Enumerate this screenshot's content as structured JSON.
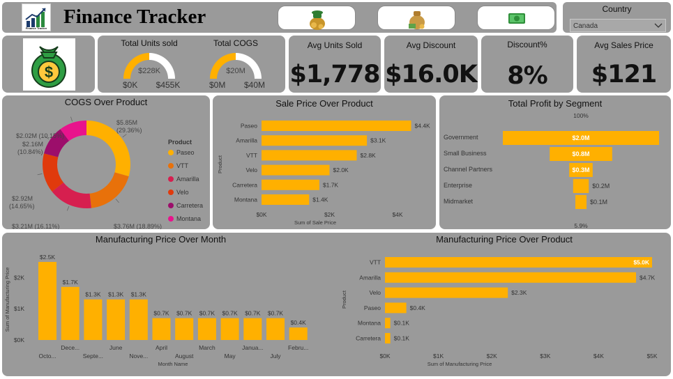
{
  "header": {
    "app_title": "Finance Tracker",
    "logo_caption": "Finance Tracker",
    "country_label": "Country",
    "country_value": "Canada"
  },
  "kpis": {
    "units_sold": {
      "label": "Total Units sold",
      "center": "$228K",
      "min": "$0K",
      "max": "$455K",
      "fraction": 0.5
    },
    "cogs": {
      "label": "Total COGS",
      "center": "$20M",
      "min": "$0M",
      "max": "$40M",
      "fraction": 0.5
    },
    "avg_units_sold": {
      "label": "Avg Units Sold",
      "value": "$1,778"
    },
    "avg_discount": {
      "label": "Avg Discount",
      "value": "$16.0K"
    },
    "discount_pct": {
      "label": "Discount%",
      "value": "8%"
    },
    "avg_sales_price": {
      "label": "Avg Sales Price",
      "value": "$121"
    }
  },
  "colors": {
    "accent": "#FFB000",
    "card": "#9A9A9A",
    "donut": [
      "#FFB000",
      "#E8710A",
      "#D61F4F",
      "#E03A0C",
      "#9C0E6B",
      "#E8138C"
    ]
  },
  "chart_data": [
    {
      "id": "cogs_over_product",
      "type": "pie",
      "title": "COGS Over Product",
      "legend_title": "Product",
      "legend_position": "right",
      "categories": [
        "Paseo",
        "VTT",
        "Amarilla",
        "Velo",
        "Carretera",
        "Montana"
      ],
      "values": [
        5.85,
        3.76,
        3.21,
        2.92,
        2.16,
        2.02
      ],
      "labels": [
        "$5.85M (29.36%)",
        "$3.76M (18.89%)",
        "$3.21M (16.11%)",
        "$2.92M (14.65%)",
        "$2.16M (10.84%)",
        "$2.02M (10.15%)"
      ]
    },
    {
      "id": "sale_price_over_product",
      "type": "bar",
      "orientation": "horizontal",
      "title": "Sale Price Over Product",
      "xlabel": "Sum of Sale Price",
      "ylabel": "Product",
      "categories": [
        "Paseo",
        "Amarilla",
        "VTT",
        "Velo",
        "Carretera",
        "Montana"
      ],
      "values": [
        4.4,
        3.1,
        2.8,
        2.0,
        1.7,
        1.4
      ],
      "value_labels": [
        "$4.4K",
        "$3.1K",
        "$2.8K",
        "$2.0K",
        "$1.7K",
        "$1.4K"
      ],
      "xlim": [
        0,
        4.8
      ],
      "ticks": [
        0,
        2,
        4
      ],
      "tick_labels": [
        "$0K",
        "$2K",
        "$4K"
      ]
    },
    {
      "id": "total_profit_by_segment",
      "type": "bar",
      "orientation": "funnel",
      "title": "Total Profit by Segment",
      "top_label": "100%",
      "bottom_label": "5.9%",
      "categories": [
        "Government",
        "Small Business",
        "Channel Partners",
        "Enterprise",
        "Midmarket"
      ],
      "values": [
        2.0,
        0.8,
        0.3,
        0.2,
        0.1
      ],
      "value_labels": [
        "$2.0M",
        "$0.8M",
        "$0.3M",
        "$0.2M",
        "$0.1M"
      ]
    },
    {
      "id": "manufacturing_price_over_month",
      "type": "bar",
      "title": "Manufacturing Price Over Month",
      "xlabel": "Month Name",
      "ylabel": "Sum of Manufacturing Price",
      "categories": [
        "Octo...",
        "Dece...",
        "Septe...",
        "June",
        "Nove...",
        "April",
        "August",
        "March",
        "May",
        "Janua...",
        "July",
        "Febru..."
      ],
      "values": [
        2.5,
        1.7,
        1.3,
        1.3,
        1.3,
        0.7,
        0.7,
        0.7,
        0.7,
        0.7,
        0.7,
        0.4
      ],
      "value_labels": [
        "$2.5K",
        "$1.7K",
        "$1.3K",
        "$1.3K",
        "$1.3K",
        "$0.7K",
        "$0.7K",
        "$0.7K",
        "$0.7K",
        "$0.7K",
        "$0.7K",
        "$0.4K"
      ],
      "ylim": [
        0,
        2.7
      ],
      "ticks": [
        0,
        1,
        2
      ],
      "tick_labels": [
        "$0K",
        "$1K",
        "$2K"
      ]
    },
    {
      "id": "manufacturing_price_over_product",
      "type": "bar",
      "orientation": "horizontal",
      "title": "Manufacturing Price Over Product",
      "xlabel": "Sum of Manufacturing Price",
      "ylabel": "Product",
      "categories": [
        "VTT",
        "Amarilla",
        "Velo",
        "Paseo",
        "Montana",
        "Carretera"
      ],
      "values": [
        5.0,
        4.7,
        2.3,
        0.4,
        0.1,
        0.1
      ],
      "value_labels": [
        "$5.0K",
        "$4.7K",
        "$2.3K",
        "$0.4K",
        "$0.1K",
        "$0.1K"
      ],
      "xlim": [
        0,
        5
      ],
      "ticks": [
        0,
        1,
        2,
        3,
        4,
        5
      ],
      "tick_labels": [
        "$0K",
        "$1K",
        "$2K",
        "$3K",
        "$4K",
        "$5K"
      ]
    }
  ]
}
